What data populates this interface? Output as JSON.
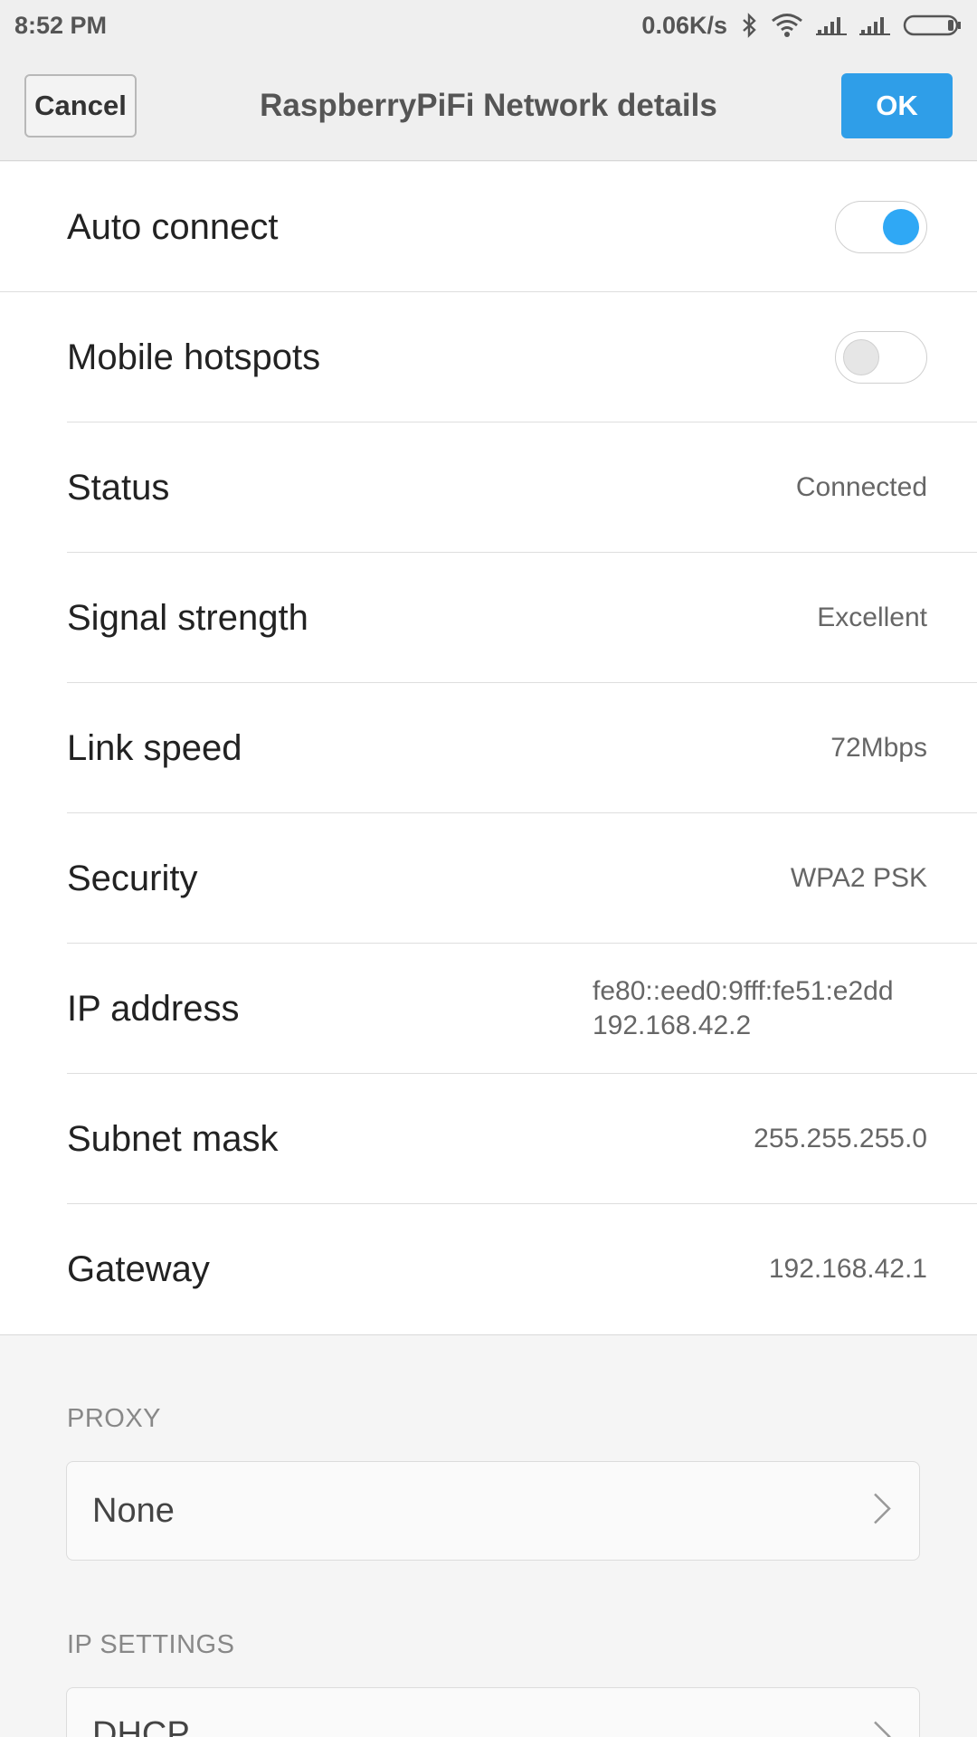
{
  "status_bar": {
    "time": "8:52 PM",
    "net_speed": "0.06K/s",
    "icons": [
      "bluetooth-icon",
      "wifi-icon",
      "signal-icon",
      "signal-icon",
      "battery-icon"
    ]
  },
  "header": {
    "cancel_label": "Cancel",
    "title": "RaspberryPiFi Network details",
    "ok_label": "OK",
    "accent_color": "#2f9ee8"
  },
  "settings": {
    "auto_connect": {
      "label": "Auto connect",
      "enabled": true
    },
    "mobile_hotspots": {
      "label": "Mobile hotspots",
      "enabled": false
    }
  },
  "details": [
    {
      "label": "Status",
      "value": "Connected"
    },
    {
      "label": "Signal strength",
      "value": "Excellent"
    },
    {
      "label": "Link speed",
      "value": "72Mbps"
    },
    {
      "label": "Security",
      "value": "WPA2 PSK"
    },
    {
      "label": "IP address",
      "value_lines": [
        "fe80::eed0:9fff:fe51:e2dd",
        "192.168.42.2"
      ]
    },
    {
      "label": "Subnet mask",
      "value": "255.255.255.0"
    },
    {
      "label": "Gateway",
      "value": "192.168.42.1"
    }
  ],
  "proxy": {
    "section_label": "PROXY",
    "value": "None"
  },
  "ip_settings": {
    "section_label": "IP SETTINGS",
    "value": "DHCP"
  }
}
